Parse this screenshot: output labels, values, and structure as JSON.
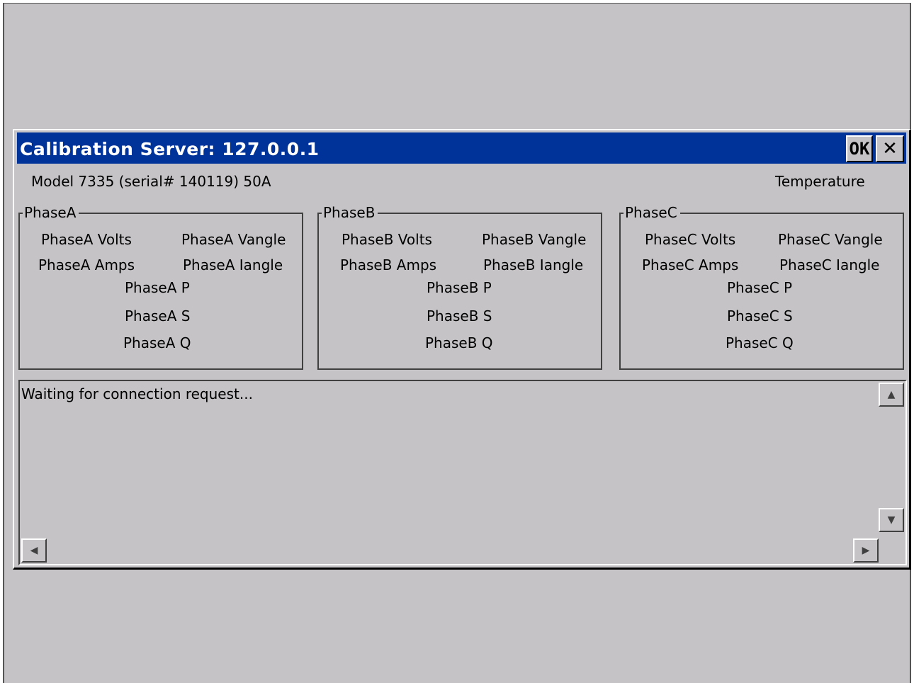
{
  "window": {
    "title": "Calibration Server: 127.0.0.1",
    "ok_label": "OK",
    "close_label": "✕"
  },
  "device": {
    "model": "Model 7335 (serial# 140119) 50A",
    "temperature": "Temperature"
  },
  "groups": [
    {
      "title": "PhaseA",
      "volts": "PhaseA Volts",
      "vangle": "PhaseA Vangle",
      "amps": "PhaseA Amps",
      "iangle": "PhaseA Iangle",
      "p": "PhaseA P",
      "s": "PhaseA S",
      "q": "PhaseA Q"
    },
    {
      "title": "PhaseB",
      "volts": "PhaseB Volts",
      "vangle": "PhaseB Vangle",
      "amps": "PhaseB Amps",
      "iangle": "PhaseB Iangle",
      "p": "PhaseB P",
      "s": "PhaseB S",
      "q": "PhaseB Q"
    },
    {
      "title": "PhaseC",
      "volts": "PhaseC Volts",
      "vangle": "PhaseC Vangle",
      "amps": "PhaseC Amps",
      "iangle": "PhaseC Iangle",
      "p": "PhaseC P",
      "s": "PhaseC S",
      "q": "PhaseC Q"
    }
  ],
  "log": {
    "text": "Waiting for connection request..."
  },
  "icons": {
    "scroll_up": "scroll-up-arrow-icon",
    "scroll_down": "scroll-down-arrow-icon",
    "scroll_left": "scroll-left-arrow-icon",
    "scroll_right": "scroll-right-arrow-icon"
  },
  "colors": {
    "titlebar": "#003399",
    "window_bg": "#c5c3c6"
  }
}
